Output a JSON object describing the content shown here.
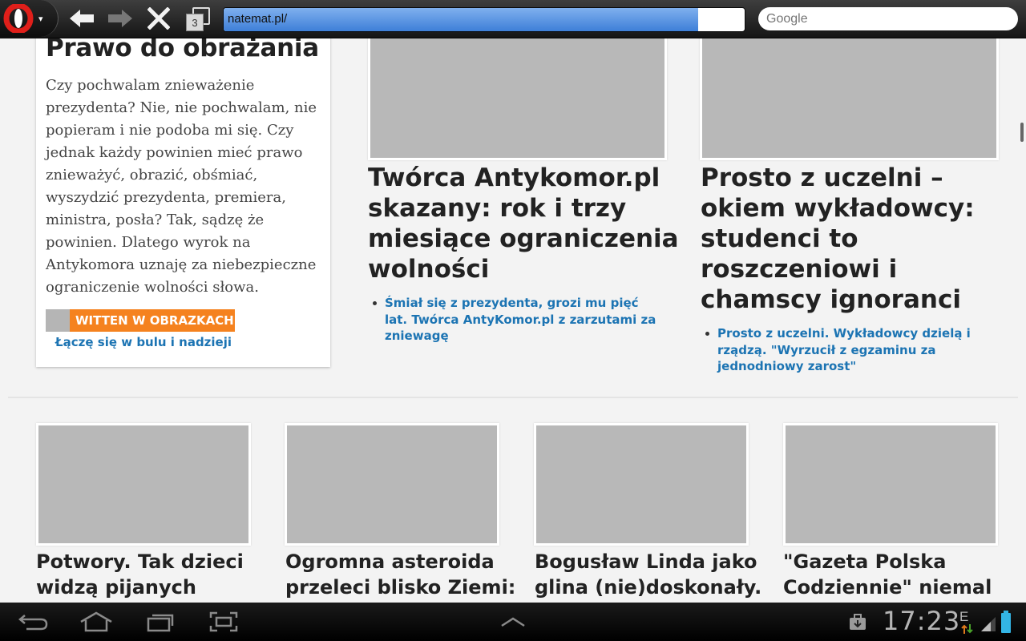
{
  "toolbar": {
    "tab_count": "3",
    "url": "natemat.pl/",
    "load_progress": 0.91,
    "search_placeholder": "Google"
  },
  "left_card": {
    "title": "Prawo do obrażania",
    "body": "Czy pochwalam znieważenie prezydenta? Nie, nie pochwalam, nie popieram i nie podoba mi się. Czy jednak każdy powinien mieć prawo znieważyć, obrazić, obśmiać, wyszydzić prezydenta, premiera, ministra, posła? Tak, sądzę że powinien. Dlatego wyrok na Antykomora uznaję za niebezpieczne ograniczenie wolności słowa.",
    "tag": "WITTEN W OBRAZKACH",
    "sub_link": "Łączę się w bulu i nadzieji"
  },
  "feature_1": {
    "title": "Twórca Antykomor.pl skazany: rok i trzy miesiące ograniczenia wolności",
    "links": [
      "Śmiał się z prezydenta, grozi mu pięć lat. Twórca AntyKomor.pl z zarzutami za zniewagę"
    ]
  },
  "feature_2": {
    "title": "Prosto z uczelni – okiem wykładowcy: studenci to roszczeniowi i chamscy ignoranci",
    "links": [
      "Prosto z uczelni. Wykładowcy dzielą i rządzą. \"Wyrzucił z egzaminu za jednodniowy zarost\""
    ]
  },
  "articles": [
    {
      "title": "Potwory. Tak dzieci widzą pijanych"
    },
    {
      "title": "Ogromna asteroida przeleci blisko Ziemi:"
    },
    {
      "title": "Bogusław Linda jako glina (nie)doskonały."
    },
    {
      "title": "\"Gazeta Polska Codziennie\" niemal"
    }
  ],
  "status_bar": {
    "time": "17:23",
    "network_type": "E"
  },
  "colors": {
    "link": "#1c74b3",
    "tag_orange": "#f5821f",
    "opera_red": "#e0201c"
  }
}
